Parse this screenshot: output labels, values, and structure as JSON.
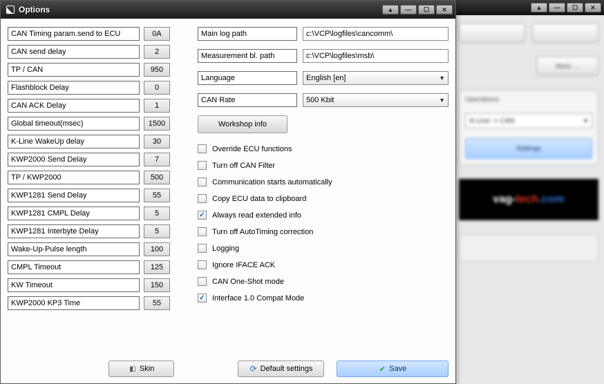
{
  "dialog": {
    "title": "Options",
    "params": [
      {
        "label": "CAN Timing param.send to ECU",
        "value": "0A"
      },
      {
        "label": "CAN send delay",
        "value": "2"
      },
      {
        "label": "TP / CAN",
        "value": "950"
      },
      {
        "label": "Flashblock Delay",
        "value": "0"
      },
      {
        "label": "CAN ACK Delay",
        "value": "1"
      },
      {
        "label": "Global timeout(msec)",
        "value": "1500"
      },
      {
        "label": "K-Line WakeUp delay",
        "value": "30"
      },
      {
        "label": "KWP2000 Send Delay",
        "value": "7"
      },
      {
        "label": "TP / KWP2000",
        "value": "500"
      },
      {
        "label": "KWP1281 Send Delay",
        "value": "55"
      },
      {
        "label": "KWP1281 CMPL Delay",
        "value": "5"
      },
      {
        "label": "KWP1281 Interbyte Delay",
        "value": "5"
      },
      {
        "label": "Wake-Up-Pulse length",
        "value": "100"
      },
      {
        "label": "CMPL Timeout",
        "value": "125"
      },
      {
        "label": "KW Timeout",
        "value": "150"
      },
      {
        "label": "KWP2000 KP3 Time",
        "value": "55"
      }
    ],
    "paths": {
      "main_log_label": "Main log path",
      "main_log_value": "c:\\VCP\\logfiles\\cancomm\\",
      "meas_label": "Measurement bl. path",
      "meas_value": "c:\\VCP\\logfiles\\msb\\",
      "language_label": "Language",
      "language_value": "English [en]",
      "canrate_label": "CAN Rate",
      "canrate_value": "500 Kbit"
    },
    "workshop_btn": "Workshop info",
    "checks": [
      {
        "label": "Override ECU functions",
        "checked": false
      },
      {
        "label": "Turn off CAN Filter",
        "checked": false
      },
      {
        "label": "Communication starts automatically",
        "checked": false
      },
      {
        "label": "Copy ECU data to clipboard",
        "checked": false
      },
      {
        "label": "Always read extended info",
        "checked": true
      },
      {
        "label": "Turn off AutoTiming correction",
        "checked": false
      },
      {
        "label": "Logging",
        "checked": false
      },
      {
        "label": "Ignore IFACE ACK",
        "checked": false
      },
      {
        "label": "CAN One-Shot mode",
        "checked": false
      },
      {
        "label": "Interface 1.0 Compat Mode",
        "checked": true
      }
    ],
    "footer": {
      "skin": "Skin",
      "default": "Default settings",
      "save": "Save"
    }
  },
  "bg": {
    "more_btn": "More ...",
    "operations_title": "Operations",
    "combo_value": "K-Line -> CAN",
    "settings_btn": "Settings",
    "logo1": "vag-",
    "logo2": "tech",
    "logo3": ".com"
  }
}
